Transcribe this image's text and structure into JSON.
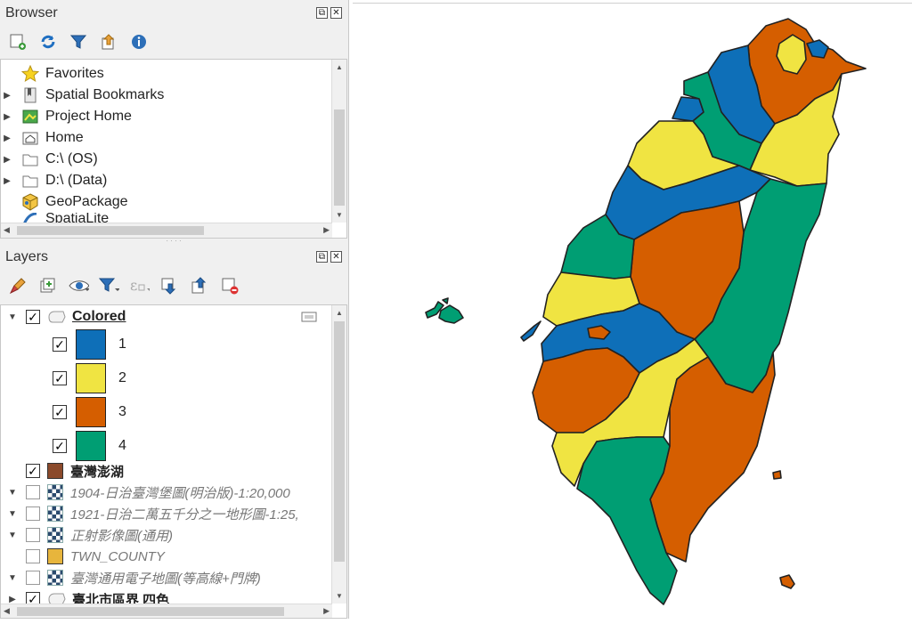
{
  "browser": {
    "title": "Browser",
    "items": [
      {
        "label": "Favorites",
        "icon": "star-icon"
      },
      {
        "label": "Spatial Bookmarks",
        "icon": "bookmark-icon"
      },
      {
        "label": "Project Home",
        "icon": "project-home-icon"
      },
      {
        "label": "Home",
        "icon": "home-icon"
      },
      {
        "label": "C:\\ (OS)",
        "icon": "folder-icon"
      },
      {
        "label": "D:\\ (Data)",
        "icon": "folder-icon"
      },
      {
        "label": "GeoPackage",
        "icon": "geopackage-icon"
      },
      {
        "label": "SpatiaLite",
        "icon": "spatialite-icon"
      }
    ]
  },
  "layers": {
    "title": "Layers",
    "group": {
      "label": "Colored"
    },
    "classes": [
      {
        "label": "1",
        "color": "#0e6fb8"
      },
      {
        "label": "2",
        "color": "#f0e442"
      },
      {
        "label": "3",
        "color": "#d55e00"
      },
      {
        "label": "4",
        "color": "#009e73"
      }
    ],
    "items": [
      {
        "label": "臺灣澎湖",
        "color": "#8b4a2b"
      },
      {
        "label": "1904-日治臺灣堡圖(明治版)-1:20,000"
      },
      {
        "label": "1921-日治二萬五千分之一地形圖-1:25,"
      },
      {
        "label": "正射影像圖(通用)"
      },
      {
        "label": "TWN_COUNTY",
        "color": "#e7b53c"
      },
      {
        "label": "臺灣通用電子地圖(等高線+門牌)"
      },
      {
        "label": "臺北市區界 四色"
      }
    ]
  },
  "map": {
    "colors": {
      "blue": "#0e6fb8",
      "yellow": "#f0e442",
      "orange": "#d55e00",
      "green": "#009e73",
      "outline": "#222222"
    }
  }
}
